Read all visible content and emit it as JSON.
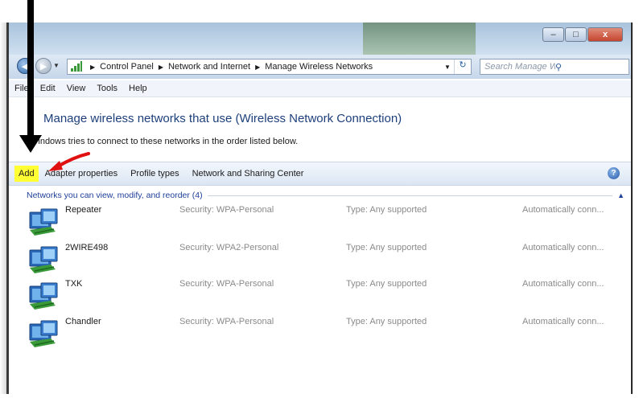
{
  "window": {
    "minimize_glyph": "–",
    "maximize_glyph": "□",
    "close_glyph": "x"
  },
  "address_bar": {
    "breadcrumbs": [
      "Control Panel",
      "Network and Internet",
      "Manage Wireless Networks"
    ],
    "search_placeholder": "Search Manage Wireless Netw..."
  },
  "menu": [
    "File",
    "Edit",
    "View",
    "Tools",
    "Help"
  ],
  "heading": "Manage wireless networks that use (Wireless Network Connection)",
  "subtext": "Windows tries to connect to these networks in the order listed below.",
  "toolbar": {
    "add_label": "Add",
    "adapter_label": "Adapter properties",
    "profile_label": "Profile types",
    "sharing_label": "Network and Sharing Center",
    "help_glyph": "?"
  },
  "group_header": "Networks you can view, modify, and reorder (4)",
  "networks": [
    {
      "name": "Repeater",
      "security": "Security: WPA-Personal",
      "type": "Type: Any supported",
      "auto": "Automatically conn..."
    },
    {
      "name": "2WIRE498",
      "security": "Security: WPA2-Personal",
      "type": "Type: Any supported",
      "auto": "Automatically conn..."
    },
    {
      "name": "TXK",
      "security": "Security: WPA-Personal",
      "type": "Type: Any supported",
      "auto": "Automatically conn..."
    },
    {
      "name": "Chandler",
      "security": "Security: WPA-Personal",
      "type": "Type: Any supported",
      "auto": "Automatically conn..."
    }
  ],
  "annotations": {
    "highlight_color": "#ffff33",
    "pointer_color": "#000000",
    "arrow_color": "#e01010"
  },
  "icons": {
    "back": "back-arrow-icon",
    "forward": "forward-arrow-icon",
    "network": "wireless-network-icon",
    "search": "search-icon",
    "help": "help-icon",
    "refresh": "refresh-icon"
  }
}
